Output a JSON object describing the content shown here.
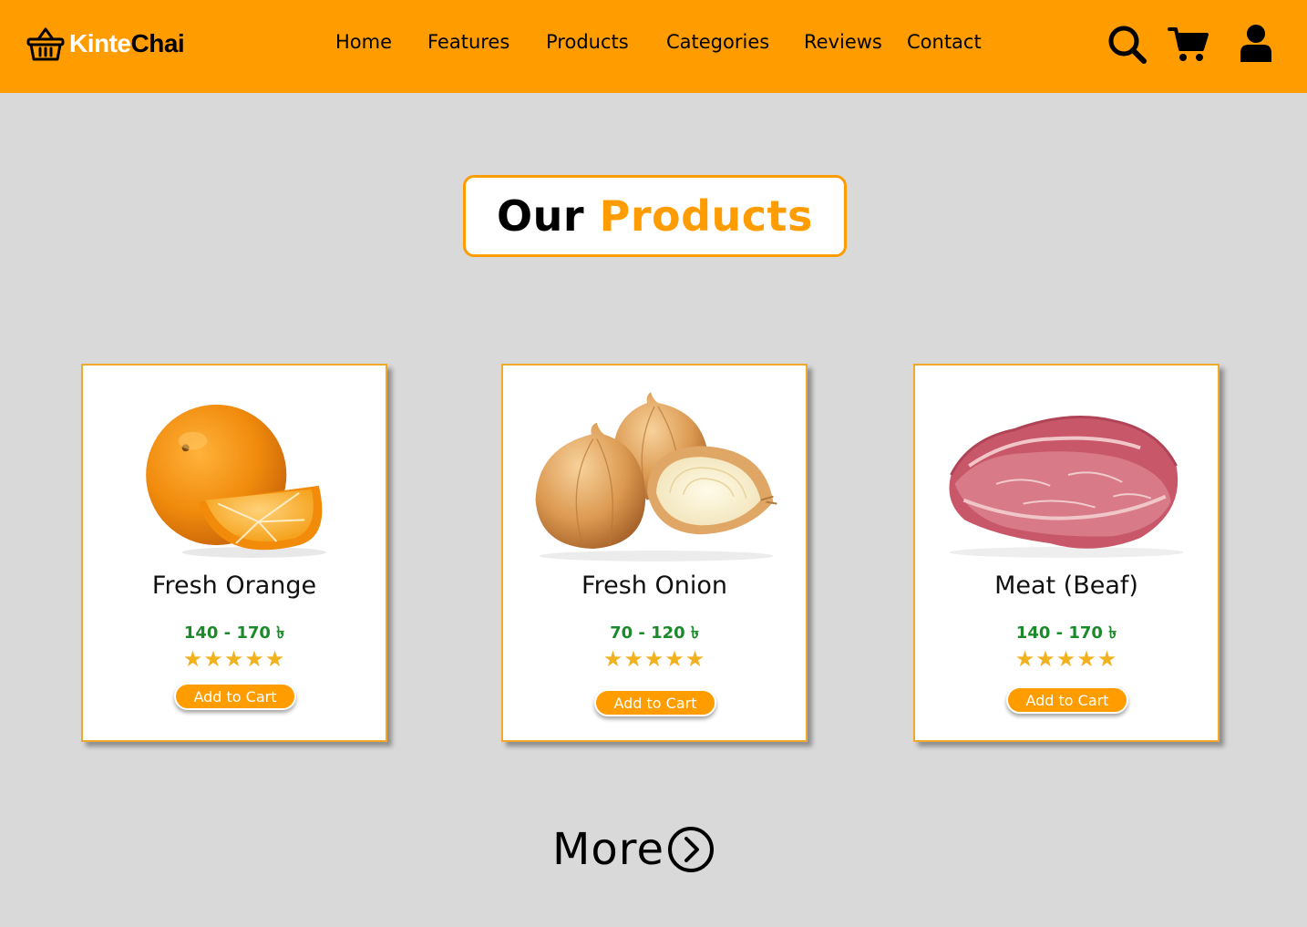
{
  "brand": {
    "name_part1": "Kinte",
    "name_part2": "Chai",
    "icon": "basket-icon"
  },
  "nav": {
    "items": [
      {
        "label": "Home"
      },
      {
        "label": "Features"
      },
      {
        "label": "Products"
      },
      {
        "label": "Categories"
      },
      {
        "label": "Reviews"
      },
      {
        "label": "Contact"
      }
    ]
  },
  "header_icons": [
    "search-icon",
    "cart-icon",
    "user-icon"
  ],
  "section": {
    "title_part1": "Our",
    "title_part2": "Products"
  },
  "products": [
    {
      "name": "Fresh Orange",
      "price": "140 - 170 ৳",
      "rating": 5,
      "stars": "★★★★★",
      "button": "Add to Cart"
    },
    {
      "name": "Fresh Onion",
      "price": "70 - 120 ৳",
      "rating": 5,
      "stars": "★★★★★",
      "button": "Add to Cart"
    },
    {
      "name": "Meat (Beaf)",
      "price": "140 - 170 ৳",
      "rating": 5,
      "stars": "★★★★★",
      "button": "Add to Cart"
    }
  ],
  "more": {
    "label": "More",
    "icon": "chevron-right-circle-icon"
  },
  "colors": {
    "brand_orange": "#ff9c00",
    "page_bg": "#d9d9d9",
    "price_green": "#1c8a2b",
    "star_yellow": "#f2b21f"
  }
}
